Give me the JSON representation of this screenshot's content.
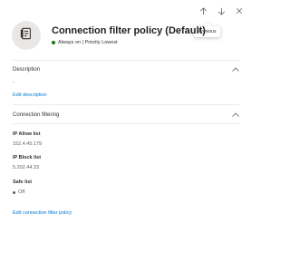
{
  "nav": {
    "up_icon": "arrow-up-icon",
    "down_icon": "arrow-down-icon",
    "close_icon": "close-icon"
  },
  "tooltip": {
    "text": "Previous"
  },
  "header": {
    "icon": "document-icon",
    "title": "Connection filter policy (Default)",
    "status": "Always on | Priority Lowest",
    "status_color": "#107c10"
  },
  "description": {
    "heading": "Description",
    "value": "-",
    "edit_link": "Edit description"
  },
  "connection_filtering": {
    "heading": "Connection filtering",
    "ip_allow_label": "IP Allow list",
    "ip_allow_value": "152.4.45.179",
    "ip_block_label": "IP Block list",
    "ip_block_value": "5.202.44.33",
    "safe_list_label": "Safe list",
    "safe_list_value": "Off",
    "edit_link": "Edit connection filter policy"
  },
  "colors": {
    "link": "#0078d4",
    "status_on": "#107c10",
    "divider": "#edebe9"
  }
}
